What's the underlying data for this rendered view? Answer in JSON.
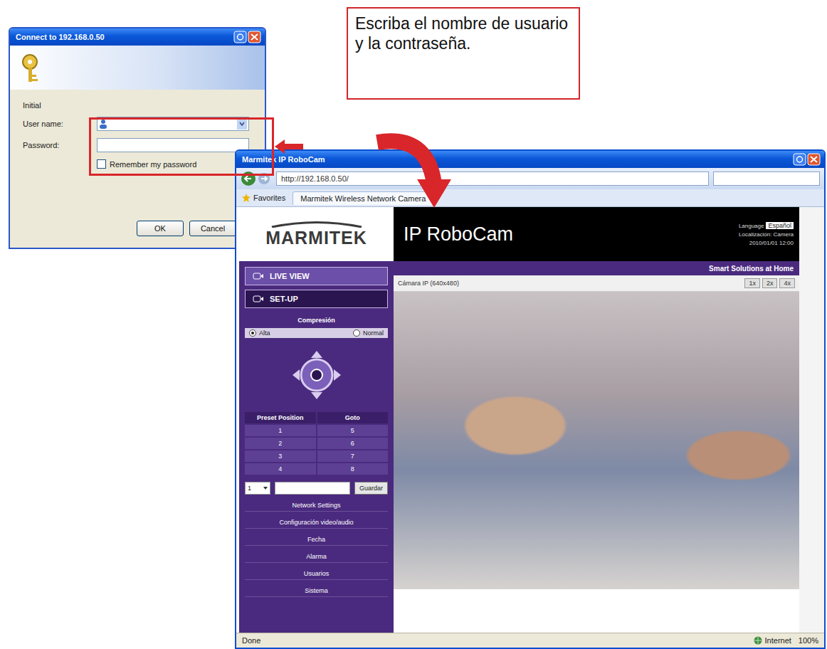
{
  "callout": {
    "text": "Escriba el nombre de usuario y la contraseña."
  },
  "login_dialog": {
    "title": "Connect to 192.168.0.50",
    "server_label": "Initial",
    "fields": [
      {
        "label": "User name:",
        "value": "",
        "kind": "combo"
      },
      {
        "label": "Password:",
        "value": "",
        "kind": "password"
      }
    ],
    "remember": {
      "label": "Remember my password",
      "checked": false
    },
    "buttons": [
      "OK",
      "Cancel"
    ]
  },
  "browser": {
    "title": "Marmitek IP RoboCam",
    "address": "http://192.168.0.50/",
    "tab": "Marmitek Wireless Network Camera",
    "favorites": "Favorites",
    "status": "Done",
    "zone": "Internet",
    "zoom": "100%"
  },
  "page": {
    "logo": "MARMITEK",
    "title": "IP RoboCam",
    "language_label": "Language",
    "language": "Español",
    "info_lines": [
      "Localización: Camera",
      "2010/01/01 12:00"
    ],
    "slogan": "Smart Solutions at Home",
    "nav": [
      {
        "label": "LIVE VIEW",
        "selected": true
      },
      {
        "label": "SET-UP",
        "selected": false
      }
    ],
    "compression": {
      "title": "Compresión",
      "options": [
        {
          "label": "Alta",
          "selected": true
        },
        {
          "label": "Normal",
          "selected": false
        }
      ]
    },
    "presets": {
      "columns": [
        "Preset Position",
        "Goto"
      ],
      "rows": [
        [
          "1",
          "5"
        ],
        [
          "2",
          "6"
        ],
        [
          "3",
          "7"
        ],
        [
          "4",
          "8"
        ]
      ]
    },
    "preset_controls": {
      "select": "1",
      "value": "",
      "button": "Guardar"
    },
    "menu": [
      "Network Settings",
      "Configuración video/audio",
      "Fecha",
      "Alarma",
      "Usuarios",
      "Sistema"
    ],
    "view_toolbar": {
      "label": "Cámara IP (640x480)",
      "buttons": [
        "1x",
        "2x",
        "4x"
      ]
    }
  }
}
